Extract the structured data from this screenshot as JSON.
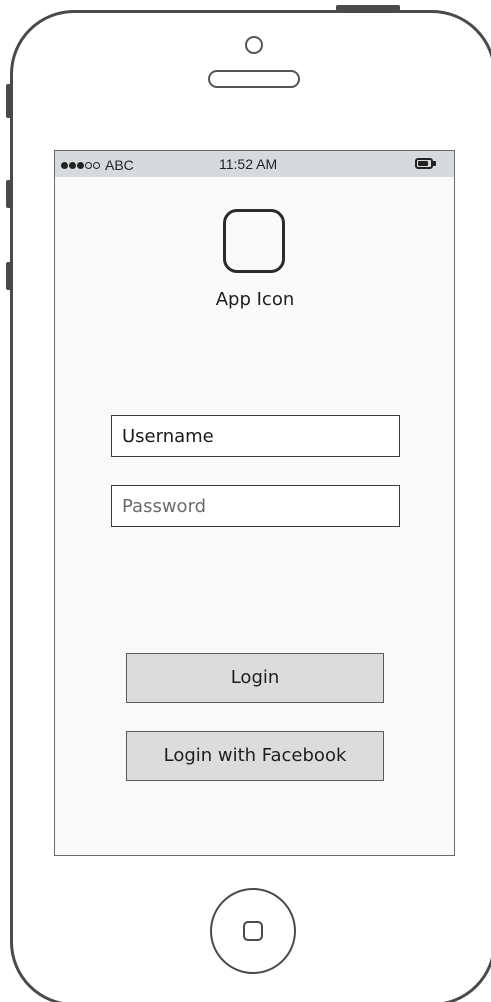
{
  "status_bar": {
    "signal_filled": 3,
    "signal_total": 5,
    "carrier": "ABC",
    "time": "11:52 AM",
    "battery_level": 0.8,
    "battery_icon": "battery-icon"
  },
  "app": {
    "icon_name": "app-icon-placeholder",
    "icon_label": "App Icon"
  },
  "form": {
    "username_value": "Username",
    "password_placeholder": "Password"
  },
  "buttons": {
    "login_label": "Login",
    "facebook_label": "Login with Facebook"
  },
  "device": {
    "home_button_icon": "home-button-icon",
    "camera_icon": "front-camera-icon",
    "speaker_icon": "earpiece-speaker-icon"
  },
  "colors": {
    "status_bar_bg": "#d6dadd",
    "button_bg": "#dcdcdc",
    "frame": "#4a4a4a"
  }
}
